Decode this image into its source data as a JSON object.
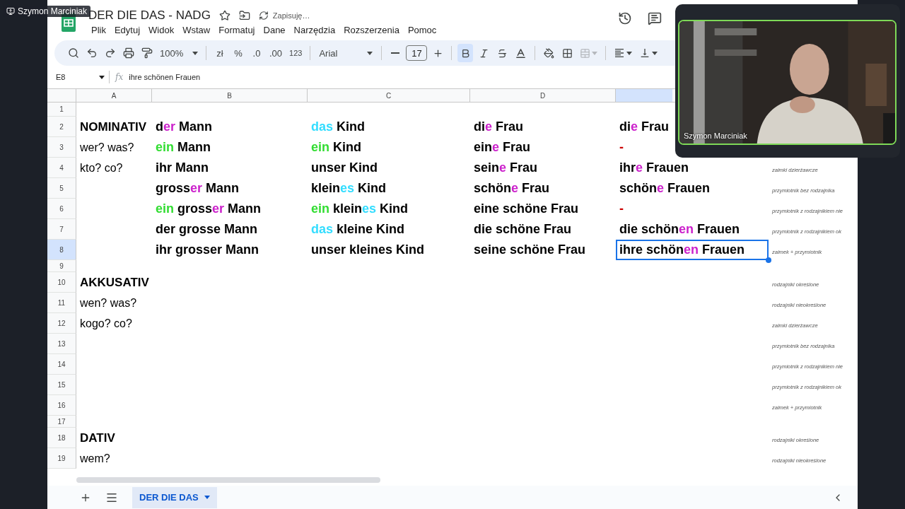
{
  "share_label": "Szymon Marciniak",
  "document": {
    "title": "DER DIE DAS - NADG",
    "save_status": "Zapisuję…"
  },
  "menu": [
    "Plik",
    "Edytuj",
    "Widok",
    "Wstaw",
    "Formatuj",
    "Dane",
    "Narzędzia",
    "Rozszerzenia",
    "Pomoc"
  ],
  "toolbar": {
    "zoom": "100%",
    "currency": "zł",
    "percent": "%",
    "decimals_less": ".0",
    "decimals_more": ".00",
    "number_format": "123",
    "font": "Arial",
    "font_size": "17",
    "bold": true,
    "italic": false,
    "strikethrough": false,
    "merge_disabled": true
  },
  "formula_bar": {
    "cell": "E8",
    "function_label": "fx",
    "value": "ihre schönen Frauen"
  },
  "columns": [
    "A",
    "B",
    "C",
    "D"
  ],
  "rows": [
    {
      "number": "1",
      "cells": {}
    },
    {
      "number": "2",
      "cells": {
        "A": {
          "kind": "heading",
          "selected": false,
          "parts": [
            {
              "text": "NOMINATIV"
            }
          ]
        },
        "B": {
          "kind": "form",
          "selected": false,
          "parts": [
            {
              "text": "d"
            },
            {
              "text": "er",
              "color": "#cc22cc"
            },
            {
              "text": " Mann"
            }
          ]
        },
        "C": {
          "kind": "form",
          "selected": false,
          "parts": [
            {
              "text": "das",
              "color": "#33ddff"
            },
            {
              "text": " Kind"
            }
          ]
        },
        "D": {
          "kind": "form",
          "selected": false,
          "parts": [
            {
              "text": "di"
            },
            {
              "text": "e",
              "color": "#cc22cc"
            },
            {
              "text": " Frau"
            }
          ]
        },
        "E": {
          "kind": "form",
          "selected": false,
          "parts": [
            {
              "text": "di"
            },
            {
              "text": "e",
              "color": "#cc22cc"
            },
            {
              "text": " Frau"
            }
          ]
        }
      }
    },
    {
      "number": "3",
      "cells": {
        "A": {
          "kind": "question",
          "selected": false,
          "parts": [
            {
              "text": "wer? was?"
            }
          ]
        },
        "B": {
          "kind": "form",
          "selected": false,
          "parts": [
            {
              "text": "ein",
              "color": "#33dd33"
            },
            {
              "text": " Mann"
            }
          ]
        },
        "C": {
          "kind": "form",
          "selected": false,
          "parts": [
            {
              "text": "ein",
              "color": "#33dd33"
            },
            {
              "text": " Kind"
            }
          ]
        },
        "D": {
          "kind": "form",
          "selected": false,
          "parts": [
            {
              "text": "ein"
            },
            {
              "text": "e",
              "color": "#cc22cc"
            },
            {
              "text": " Frau"
            }
          ]
        },
        "E": {
          "kind": "form",
          "selected": false,
          "parts": [
            {
              "text": "-",
              "color": "#cc0000"
            }
          ]
        }
      }
    },
    {
      "number": "4",
      "cells": {
        "A": {
          "kind": "question",
          "selected": false,
          "parts": [
            {
              "text": "kto? co?"
            }
          ]
        },
        "B": {
          "kind": "form",
          "selected": false,
          "parts": [
            {
              "text": "ihr Mann"
            }
          ]
        },
        "C": {
          "kind": "form",
          "selected": false,
          "parts": [
            {
              "text": "unser Kind"
            }
          ]
        },
        "D": {
          "kind": "form",
          "selected": false,
          "parts": [
            {
              "text": "sein"
            },
            {
              "text": "e",
              "color": "#cc22cc"
            },
            {
              "text": " Frau"
            }
          ]
        },
        "E": {
          "kind": "form",
          "selected": false,
          "parts": [
            {
              "text": "ihr"
            },
            {
              "text": "e",
              "color": "#cc22cc"
            },
            {
              "text": " Frauen"
            }
          ]
        },
        "F": {
          "kind": "note",
          "selected": false,
          "parts": [
            {
              "text": "zaimki dzierżawcze"
            }
          ]
        }
      }
    },
    {
      "number": "5",
      "cells": {
        "B": {
          "kind": "form",
          "selected": false,
          "parts": [
            {
              "text": "gross"
            },
            {
              "text": "er",
              "color": "#cc22cc"
            },
            {
              "text": " Mann"
            }
          ]
        },
        "C": {
          "kind": "form",
          "selected": false,
          "parts": [
            {
              "text": "klein"
            },
            {
              "text": "es",
              "color": "#33ddff"
            },
            {
              "text": " Kind"
            }
          ]
        },
        "D": {
          "kind": "form",
          "selected": false,
          "parts": [
            {
              "text": "schön"
            },
            {
              "text": "e",
              "color": "#cc22cc"
            },
            {
              "text": " Frau"
            }
          ]
        },
        "E": {
          "kind": "form",
          "selected": false,
          "parts": [
            {
              "text": "schön"
            },
            {
              "text": "e",
              "color": "#cc22cc"
            },
            {
              "text": " Frauen"
            }
          ]
        },
        "F": {
          "kind": "note",
          "selected": false,
          "parts": [
            {
              "text": "przymiotnik bez rodzajnika"
            }
          ]
        }
      }
    },
    {
      "number": "6",
      "cells": {
        "B": {
          "kind": "form",
          "selected": false,
          "parts": [
            {
              "text": "ein",
              "color": "#33dd33"
            },
            {
              "text": " gross"
            },
            {
              "text": "er",
              "color": "#cc22cc"
            },
            {
              "text": " Mann"
            }
          ]
        },
        "C": {
          "kind": "form",
          "selected": false,
          "parts": [
            {
              "text": "ein",
              "color": "#33dd33"
            },
            {
              "text": " klein"
            },
            {
              "text": "es",
              "color": "#33ddff"
            },
            {
              "text": " Kind"
            }
          ]
        },
        "D": {
          "kind": "form",
          "selected": false,
          "parts": [
            {
              "text": "eine schöne Frau"
            }
          ]
        },
        "E": {
          "kind": "form",
          "selected": false,
          "parts": [
            {
              "text": "-",
              "color": "#cc0000"
            }
          ]
        },
        "F": {
          "kind": "note",
          "selected": false,
          "parts": [
            {
              "text": "przymiotnik z rodzajnikiem nie"
            }
          ]
        }
      }
    },
    {
      "number": "7",
      "cells": {
        "B": {
          "kind": "form",
          "selected": false,
          "parts": [
            {
              "text": "der grosse Mann"
            }
          ]
        },
        "C": {
          "kind": "form",
          "selected": false,
          "parts": [
            {
              "text": "das",
              "color": "#33ddff"
            },
            {
              "text": " kleine Kind"
            }
          ]
        },
        "D": {
          "kind": "form",
          "selected": false,
          "parts": [
            {
              "text": "die schöne Frau"
            }
          ]
        },
        "E": {
          "kind": "form",
          "selected": false,
          "parts": [
            {
              "text": "die schön"
            },
            {
              "text": "en",
              "color": "#cc22cc"
            },
            {
              "text": " Frauen"
            }
          ]
        },
        "F": {
          "kind": "note",
          "selected": false,
          "parts": [
            {
              "text": "przymiotnik z rodzajnikiem ok"
            }
          ]
        }
      }
    },
    {
      "number": "8",
      "cells": {
        "B": {
          "kind": "form",
          "selected": false,
          "parts": [
            {
              "text": "ihr grosser Mann"
            }
          ]
        },
        "C": {
          "kind": "form",
          "selected": false,
          "parts": [
            {
              "text": "unser kleines Kind"
            }
          ]
        },
        "D": {
          "kind": "form",
          "selected": false,
          "parts": [
            {
              "text": "seine schöne Frau"
            }
          ]
        },
        "E": {
          "kind": "form",
          "selected": true,
          "parts": [
            {
              "text": "ihre schön"
            },
            {
              "text": "en",
              "color": "#cc22cc"
            },
            {
              "text": " Frauen"
            }
          ]
        },
        "F": {
          "kind": "note",
          "selected": false,
          "parts": [
            {
              "text": "zaimek + przymiotnik"
            }
          ]
        }
      }
    },
    {
      "number": "9",
      "cells": {}
    },
    {
      "number": "10",
      "cells": {
        "A": {
          "kind": "heading",
          "selected": false,
          "parts": [
            {
              "text": "AKKUSATIV"
            }
          ]
        },
        "F": {
          "kind": "note",
          "selected": false,
          "parts": [
            {
              "text": "rodzajniki określone"
            }
          ]
        }
      }
    },
    {
      "number": "11",
      "cells": {
        "A": {
          "kind": "question",
          "selected": false,
          "parts": [
            {
              "text": "wen? was?"
            }
          ]
        },
        "F": {
          "kind": "note",
          "selected": false,
          "parts": [
            {
              "text": "rodzajniki nieokreślone"
            }
          ]
        }
      }
    },
    {
      "number": "12",
      "cells": {
        "A": {
          "kind": "question",
          "selected": false,
          "parts": [
            {
              "text": "kogo? co?"
            }
          ]
        },
        "F": {
          "kind": "note",
          "selected": false,
          "parts": [
            {
              "text": "zaimki dzierżawcze"
            }
          ]
        }
      }
    },
    {
      "number": "13",
      "cells": {
        "F": {
          "kind": "note",
          "selected": false,
          "parts": [
            {
              "text": "przymiotnik bez rodzajnika"
            }
          ]
        }
      }
    },
    {
      "number": "14",
      "cells": {
        "F": {
          "kind": "note",
          "selected": false,
          "parts": [
            {
              "text": "przymiotnik z rodzajnikiem nie"
            }
          ]
        }
      }
    },
    {
      "number": "15",
      "cells": {
        "F": {
          "kind": "note",
          "selected": false,
          "parts": [
            {
              "text": "przymiotnik z rodzajnikiem ok"
            }
          ]
        }
      }
    },
    {
      "number": "16",
      "cells": {
        "F": {
          "kind": "note",
          "selected": false,
          "parts": [
            {
              "text": "zaimek + przymiotnik"
            }
          ]
        }
      }
    },
    {
      "number": "17",
      "cells": {}
    },
    {
      "number": "18",
      "cells": {
        "A": {
          "kind": "heading",
          "selected": false,
          "parts": [
            {
              "text": "DATIV"
            }
          ]
        },
        "F": {
          "kind": "note",
          "selected": false,
          "parts": [
            {
              "text": "rodzajniki określone"
            }
          ]
        }
      }
    },
    {
      "number": "19",
      "cells": {
        "A": {
          "kind": "question",
          "selected": false,
          "parts": [
            {
              "text": "wem?"
            }
          ]
        },
        "F": {
          "kind": "note",
          "selected": false,
          "parts": [
            {
              "text": "rodzajniki nieokreślone"
            }
          ]
        }
      }
    }
  ],
  "sheet_tabs": [
    {
      "label": "DER DIE DAS",
      "selected": true
    }
  ],
  "video": {
    "name": "Szymon Marciniak"
  }
}
